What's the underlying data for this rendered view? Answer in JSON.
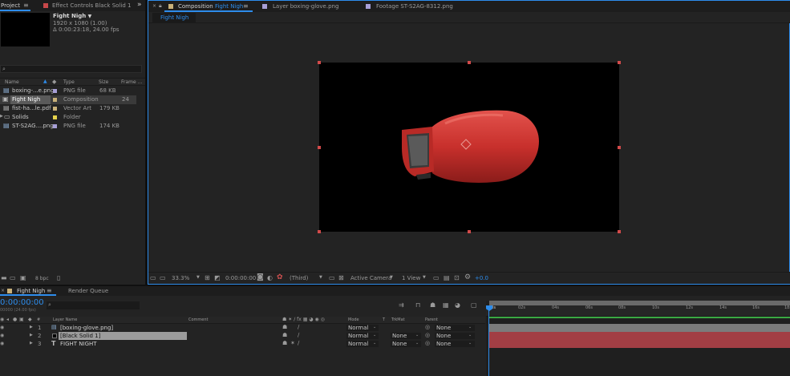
{
  "project_panel": {
    "tab_project": "Project",
    "tab_effect_controls": "Effect Controls Black Solid 1",
    "comp_name": "Fight Nigh",
    "comp_info_1": "1920 x 1080 (1.00)",
    "comp_info_2": "Δ 0:00:23:18, 24.00 fps",
    "search_placeholder": "",
    "columns": {
      "name": "Name",
      "type": "Type",
      "size": "Size",
      "frame": "Frame ..."
    },
    "items": [
      {
        "name": "boxing-...e.png",
        "type": "PNG file",
        "size": "68 KB",
        "frame": "",
        "color": "#a79fd7",
        "icon": "image-file-icon"
      },
      {
        "name": "Fight Nigh",
        "type": "Composition",
        "size": "",
        "frame": "24",
        "color": "#c9b17a",
        "icon": "composition-icon"
      },
      {
        "name": "fist-ha...le.pdf",
        "type": "Vector Art",
        "size": "179 KB",
        "frame": "",
        "color": "#c9b17a",
        "icon": "pdf-file-icon"
      },
      {
        "name": "Solids",
        "type": "Folder",
        "size": "",
        "frame": "",
        "color": "#e6d34c",
        "icon": "folder-icon"
      },
      {
        "name": "ST-S2AG....png",
        "type": "PNG file",
        "size": "174 KB",
        "frame": "",
        "color": "#a79fd7",
        "icon": "image-file-icon"
      }
    ],
    "bpc_label": "8 bpc"
  },
  "viewer": {
    "tab_composition": "Composition",
    "tab_composition_name": "Fight Nigh",
    "tab_layer": "Layer boxing-glove.png",
    "tab_footage": "Footage ST-S2AG-8312.png",
    "sub_tab": "Fight Nigh",
    "toolbar": {
      "zoom": "33.3%",
      "timecode": "0:00:00:00",
      "resolution": "(Third)",
      "camera": "Active Camera",
      "views": "1 View",
      "exposure": "+0.0"
    }
  },
  "timeline": {
    "tab_comp": "Fight Nigh",
    "tab_render": "Render Queue",
    "timecode": "0:00:00:00",
    "fps_sub": "00000 (24.00 fps)",
    "columns": {
      "num": "#",
      "layer_name": "Layer Name",
      "comment": "Comment",
      "mode": "Mode",
      "t": "T",
      "trkmat": "TrkMat",
      "parent": "Parent"
    },
    "layers": [
      {
        "num": "1",
        "name": "[boxing-glove.png]",
        "mode": "Normal",
        "trkmat": "",
        "parent": "None",
        "label_color": "#a79fd7",
        "type_icon": "image-layer-icon",
        "bar_color": "#7b7b7b"
      },
      {
        "num": "2",
        "name": "[Black Solid 1]",
        "mode": "Normal",
        "trkmat": "None",
        "parent": "None",
        "label_color": "#c7484a",
        "type_icon": "solid-layer-icon",
        "bar_color": "#a23e44"
      },
      {
        "num": "3",
        "name": "FIGHT NIGHT",
        "mode": "Normal",
        "trkmat": "None",
        "parent": "None",
        "label_color": "#c7484a",
        "type_icon": "text-layer-icon",
        "bar_color": "#a23e44"
      }
    ],
    "ruler_labels": [
      "00s",
      "02s",
      "04s",
      "06s",
      "08s",
      "10s",
      "12s",
      "14s",
      "16s",
      "18s"
    ]
  }
}
